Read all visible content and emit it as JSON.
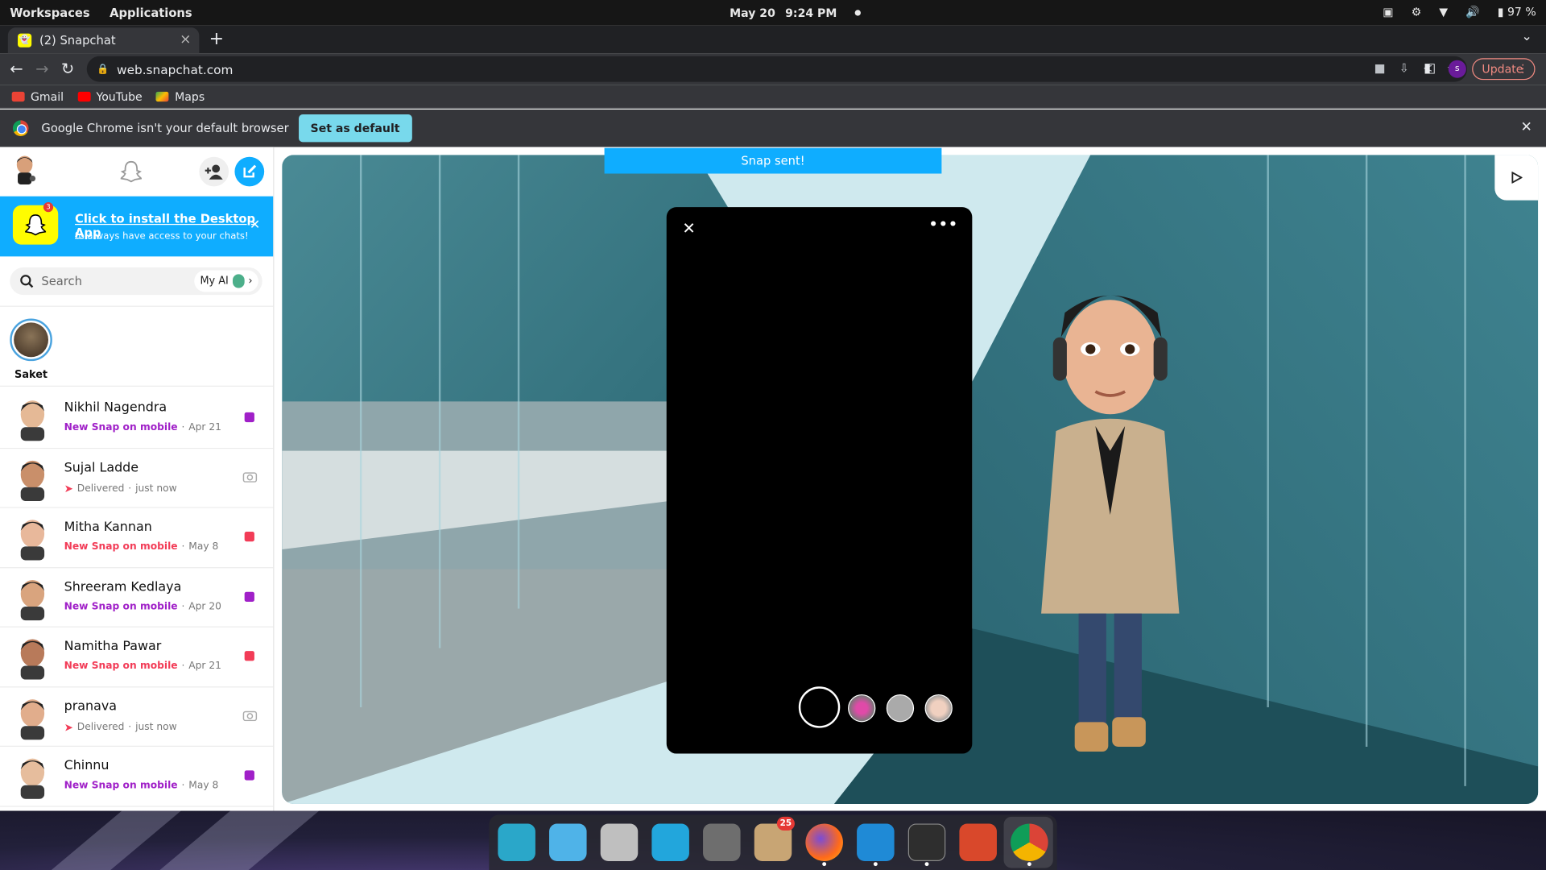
{
  "topbar": {
    "workspaces": "Workspaces",
    "applications": "Applications",
    "date": "May 20",
    "time": "9:24 PM",
    "battery": "97 %"
  },
  "browser": {
    "tab_title": "(2) Snapchat",
    "url": "web.snapchat.com",
    "profile_initial": "s",
    "update_label": "Update",
    "bookmarks": [
      "Gmail",
      "YouTube",
      "Maps"
    ],
    "infobar_text": "Google Chrome isn't your default browser",
    "set_default_label": "Set as default"
  },
  "snapchat": {
    "promo_title": "Click to install the Desktop App",
    "promo_subtitle": "to always have access to your chats!",
    "promo_badge": "3",
    "search_placeholder": "Search",
    "myai_label": "My AI",
    "story_name": "Saket",
    "snap_sent": "Snap sent!",
    "chats": [
      {
        "name": "Nikhil Nagendra",
        "status": "New Snap on mobile",
        "time": "Apr 21",
        "type": "new",
        "color": "#a020c8"
      },
      {
        "name": "Sujal Ladde",
        "status": "Delivered",
        "time": "just now",
        "type": "delivered",
        "color": "#f23c57"
      },
      {
        "name": "Mitha Kannan",
        "status": "New Snap on mobile",
        "time": "May 8",
        "type": "new",
        "color": "#f23c57"
      },
      {
        "name": "Shreeram Kedlaya",
        "status": "New Snap on mobile",
        "time": "Apr 20",
        "type": "new",
        "color": "#a020c8"
      },
      {
        "name": "Namitha Pawar",
        "status": "New Snap on mobile",
        "time": "Apr 21",
        "type": "new",
        "color": "#f23c57"
      },
      {
        "name": "pranava",
        "status": "Delivered",
        "time": "just now",
        "type": "delivered",
        "color": "#f23c57"
      },
      {
        "name": "Chinnu",
        "status": "New Snap on mobile",
        "time": "May 8",
        "type": "new",
        "color": "#a020c8"
      }
    ]
  },
  "dock": {
    "badge_count": "25"
  },
  "colors": {
    "snap_blue": "#0fadff",
    "snap_yellow": "#fffc00",
    "chrome_dark": "#202124"
  }
}
